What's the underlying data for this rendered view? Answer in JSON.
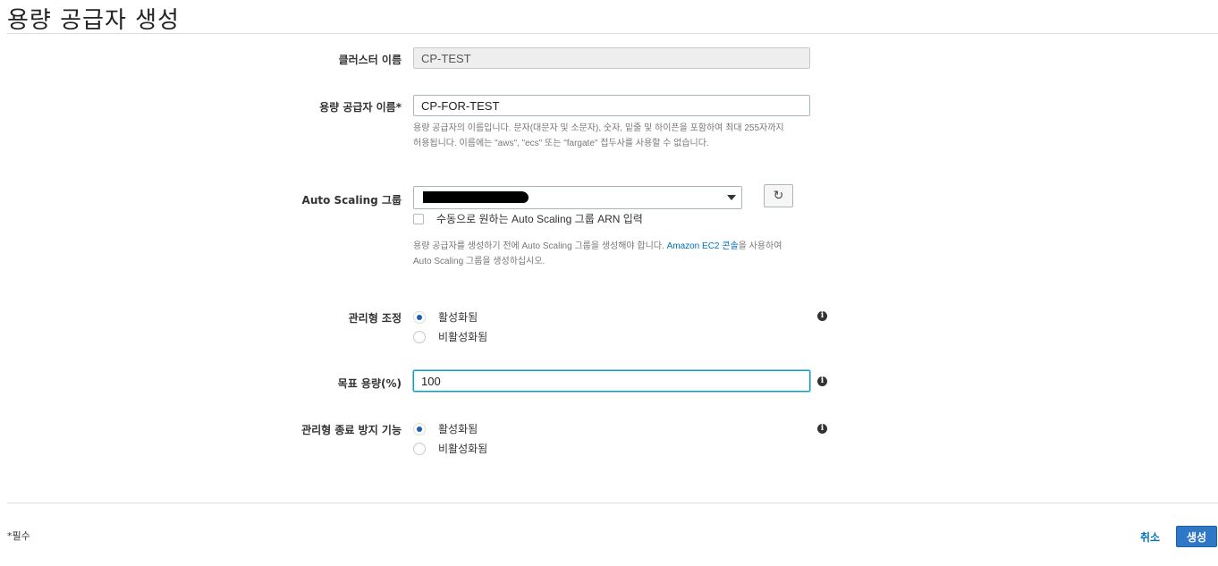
{
  "page": {
    "title": "용량 공급자 생성"
  },
  "form": {
    "cluster_name": {
      "label": "클러스터 이름",
      "value": "CP-TEST"
    },
    "provider_name": {
      "label": "용량 공급자 이름*",
      "value": "CP-FOR-TEST",
      "help_line1": "용량 공급자의 이름입니다. 문자(대문자 및 소문자), 숫자, 밑줄 및 하이픈을 포함하여 최대 255자까지",
      "help_line2": "허용됩니다. 이름에는 \"aws\", \"ecs\" 또는 \"fargate\" 접두사를 사용할 수 없습니다."
    },
    "asg": {
      "label": "Auto Scaling 그룹",
      "selected": "",
      "manual_arn_label": "수동으로 원하는 Auto Scaling 그룹 ARN 입력",
      "help_part1": "용량 공급자를 생성하기 전에 Auto Scaling 그룹을 생성해야 합니다. ",
      "help_link": "Amazon EC2 콘솔",
      "help_part2": "을 사용하여",
      "help_line2": "Auto Scaling 그룹을 생성하십시오."
    },
    "managed_scaling": {
      "label": "관리형 조정",
      "options": [
        "활성화됨",
        "비활성화됨"
      ],
      "selected": "활성화됨"
    },
    "target_capacity": {
      "label": "목표 용량(%)",
      "value": "100"
    },
    "termination_protection": {
      "label": "관리형 종료 방지 기능",
      "options": [
        "활성화됨",
        "비활성화됨"
      ],
      "selected": "활성화됨"
    }
  },
  "footer": {
    "required_note": "*필수",
    "cancel_label": "취소",
    "create_label": "생성"
  },
  "icons": {
    "info": "info-icon",
    "refresh": "refresh-icon",
    "dropdown": "chevron-down-icon"
  },
  "colors": {
    "primary": "#2f77c7",
    "link": "#0073bb",
    "radio_selected": "#1a5fb4"
  }
}
